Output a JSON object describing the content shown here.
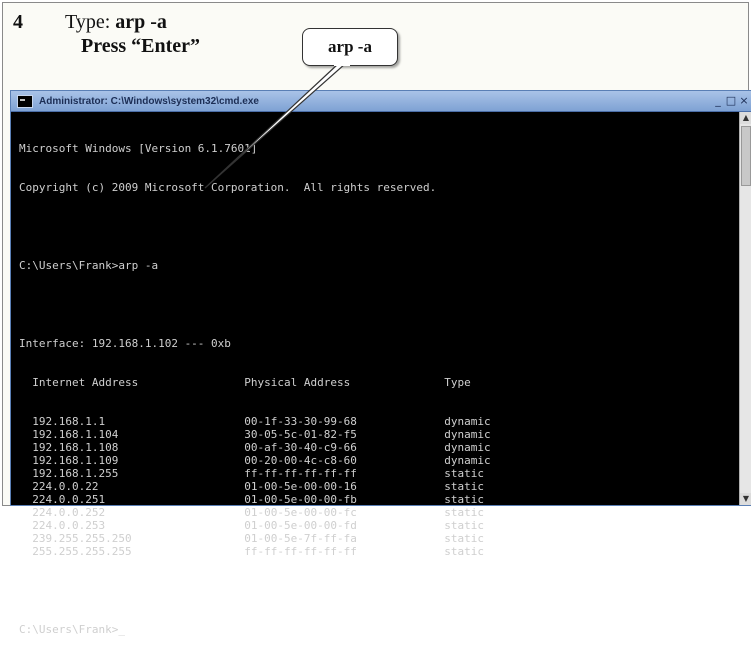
{
  "step": {
    "number": "4",
    "type_label": "Type:",
    "type_command": "arp -a",
    "press_line": "Press “Enter”"
  },
  "callout": {
    "text": "arp -a"
  },
  "window": {
    "title": "Administrator: C:\\Windows\\system32\\cmd.exe",
    "minimize": "_",
    "maximize": "□",
    "close": "×"
  },
  "console": {
    "header_line1": "Microsoft Windows [Version 6.1.7601]",
    "header_line2": "Copyright (c) 2009 Microsoft Corporation.  All rights reserved.",
    "prompt_command": "C:\\Users\\Frank>arp -a",
    "interface_line": "Interface: 192.168.1.102 --- 0xb",
    "columns": [
      "Internet Address",
      "Physical Address",
      "Type"
    ],
    "rows": [
      [
        "192.168.1.1",
        "00-1f-33-30-99-68",
        "dynamic"
      ],
      [
        "192.168.1.104",
        "30-05-5c-01-82-f5",
        "dynamic"
      ],
      [
        "192.168.1.108",
        "00-af-30-40-c9-66",
        "dynamic"
      ],
      [
        "192.168.1.109",
        "00-20-00-4c-c8-60",
        "dynamic"
      ],
      [
        "192.168.1.255",
        "ff-ff-ff-ff-ff-ff",
        "static"
      ],
      [
        "224.0.0.22",
        "01-00-5e-00-00-16",
        "static"
      ],
      [
        "224.0.0.251",
        "01-00-5e-00-00-fb",
        "static"
      ],
      [
        "224.0.0.252",
        "01-00-5e-00-00-fc",
        "static"
      ],
      [
        "224.0.0.253",
        "01-00-5e-00-00-fd",
        "static"
      ],
      [
        "239.255.255.250",
        "01-00-5e-7f-ff-fa",
        "static"
      ],
      [
        "255.255.255.255",
        "ff-ff-ff-ff-ff-ff",
        "static"
      ]
    ],
    "final_prompt": "C:\\Users\\Frank>_"
  }
}
